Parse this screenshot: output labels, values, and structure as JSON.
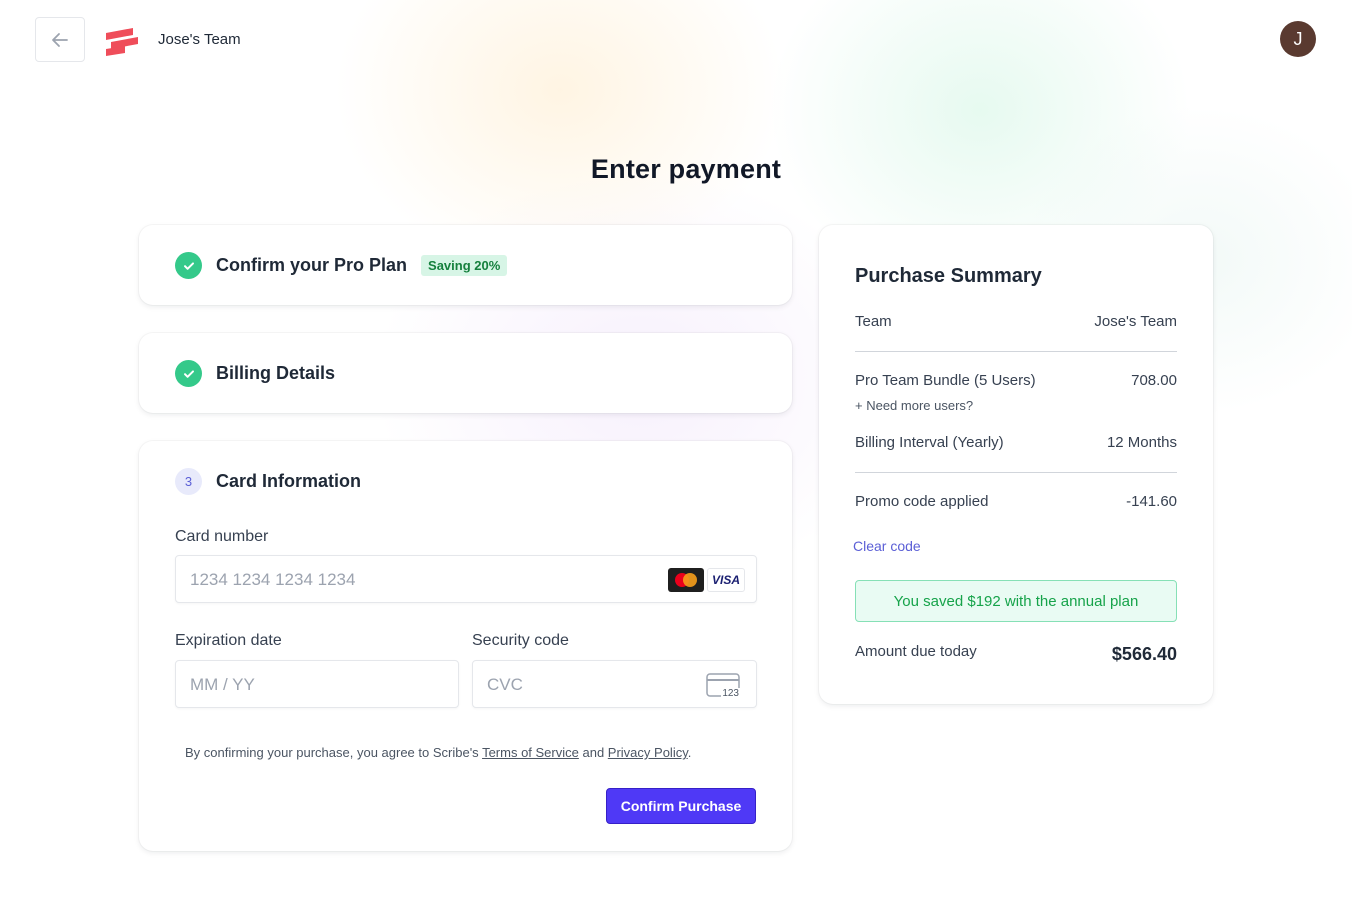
{
  "header": {
    "team_name": "Jose's Team",
    "avatar_initial": "J",
    "brand_color": "#ef4d5a"
  },
  "page": {
    "title": "Enter payment"
  },
  "steps": {
    "plan": {
      "title": "Confirm your Pro Plan",
      "badge": "Saving 20%"
    },
    "billing": {
      "title": "Billing Details"
    },
    "card": {
      "number": "3",
      "title": "Card Information"
    }
  },
  "card_form": {
    "card_number_label": "Card number",
    "card_number_placeholder": "1234 1234 1234 1234",
    "expiration_label": "Expiration date",
    "expiration_placeholder": "MM / YY",
    "security_label": "Security code",
    "security_placeholder": "CVC",
    "cvc_icon_text": "123",
    "visa_text": "VISA",
    "legal_prefix": "By confirming your purchase, you agree to Scribe's ",
    "terms_link": "Terms of Service",
    "legal_and": " and ",
    "privacy_link": "Privacy Policy",
    "legal_suffix": ".",
    "confirm_button": "Confirm Purchase"
  },
  "summary": {
    "title": "Purchase Summary",
    "team_label": "Team",
    "team_value": "Jose's Team",
    "bundle_label": "Pro Team Bundle (5 Users)",
    "bundle_value": "708.00",
    "more_users_link": "+ Need more users?",
    "interval_label": "Billing Interval (Yearly)",
    "interval_value": "12 Months",
    "promo_label": "Promo code applied",
    "promo_value": "-141.60",
    "clear_code": "Clear code",
    "saved_message": "You saved $192 with the annual plan",
    "due_label": "Amount due today",
    "due_value": "$566.40"
  },
  "colors": {
    "accent": "#4f39f6",
    "success": "#34c98a",
    "link": "#5b5fd6"
  }
}
